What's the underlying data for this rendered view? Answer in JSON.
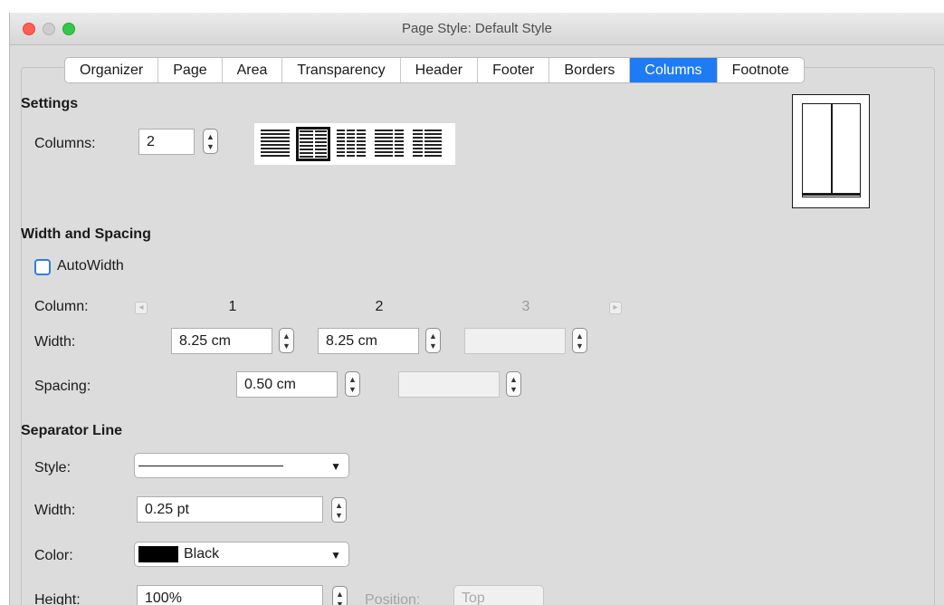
{
  "window": {
    "title": "Page Style: Default Style"
  },
  "tabs": [
    "Organizer",
    "Page",
    "Area",
    "Transparency",
    "Header",
    "Footer",
    "Borders",
    "Columns",
    "Footnote"
  ],
  "active_tab": "Columns",
  "settings": {
    "heading": "Settings",
    "columns_label": "Columns:",
    "columns_value": "2"
  },
  "width_spacing": {
    "heading": "Width and Spacing",
    "autowidth_label": "AutoWidth",
    "autowidth_checked": false,
    "column_label": "Column:",
    "column_numbers": [
      "1",
      "2",
      "3"
    ],
    "width_label": "Width:",
    "widths": [
      "8.25 cm",
      "8.25 cm",
      ""
    ],
    "spacing_label": "Spacing:",
    "spacings": [
      "0.50 cm",
      ""
    ]
  },
  "separator": {
    "heading": "Separator Line",
    "style_label": "Style:",
    "width_label": "Width:",
    "width_value": "0.25 pt",
    "color_label": "Color:",
    "color_value": "Black",
    "color_hex": "#000000",
    "height_label": "Height:",
    "height_value": "100%",
    "position_label": "Position:",
    "position_value": "Top"
  },
  "colors": {
    "accent": "#1f7bf3",
    "checkbox_border": "#2f7de1"
  }
}
